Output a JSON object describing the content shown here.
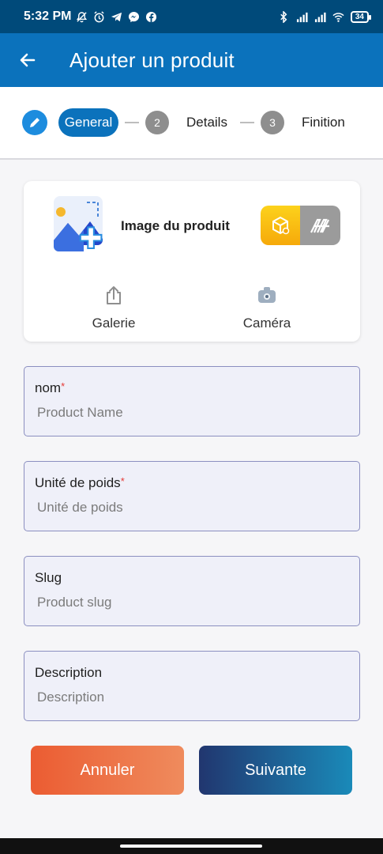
{
  "status_bar": {
    "time": "5:32 PM",
    "battery": "34"
  },
  "app_bar": {
    "title": "Ajouter un produit",
    "back_icon": "arrow-left-icon"
  },
  "stepper": {
    "steps": [
      {
        "number": "",
        "label": "General",
        "active": true
      },
      {
        "number": "2",
        "label": "Details",
        "active": false
      },
      {
        "number": "3",
        "label": "Finition",
        "active": false
      }
    ]
  },
  "image_card": {
    "title": "Image du produit",
    "sources": [
      {
        "label": "Galerie",
        "icon": "upload-icon"
      },
      {
        "label": "Caméra",
        "icon": "camera-icon"
      }
    ]
  },
  "form": {
    "fields": [
      {
        "label": "nom",
        "required": true,
        "placeholder": "Product Name",
        "value": ""
      },
      {
        "label": "Unité de poids",
        "required": true,
        "placeholder": "Unité de poids",
        "value": ""
      },
      {
        "label": "Slug",
        "required": false,
        "placeholder": "Product slug",
        "value": ""
      },
      {
        "label": "Description",
        "required": false,
        "placeholder": "Description",
        "value": ""
      }
    ],
    "required_marker": "*"
  },
  "actions": {
    "cancel_label": "Annuler",
    "next_label": "Suivante"
  },
  "colors": {
    "app_bar": "#0b72bc",
    "status_bar": "#004a7a",
    "cancel_start": "#eb5c32",
    "next_start": "#21366f"
  }
}
